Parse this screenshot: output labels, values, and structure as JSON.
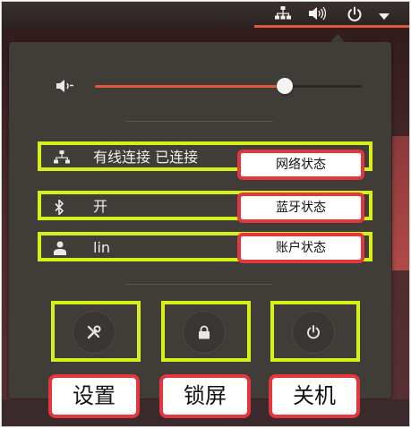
{
  "topbar": {
    "icons": [
      "network-wired-icon",
      "speaker-icon",
      "power-icon",
      "dropdown-arrow-icon"
    ]
  },
  "volume": {
    "icon": "speaker-low-icon",
    "level_percent": 71
  },
  "rows": [
    {
      "icon": "network-wired-icon",
      "label": "有线连接 已连接",
      "callout": "网络状态"
    },
    {
      "icon": "bluetooth-icon",
      "label": "开",
      "callout": "蓝牙状态"
    },
    {
      "icon": "user-icon",
      "label": "lin",
      "callout": "账户状态"
    }
  ],
  "buttons": [
    {
      "icon": "settings-tools-icon",
      "label": "设置"
    },
    {
      "icon": "lock-icon",
      "label": "锁屏"
    },
    {
      "icon": "power-icon",
      "label": "关机"
    }
  ],
  "colors": {
    "highlight_box": "#d8f01a",
    "callout_border": "#e4363c",
    "accent": "#e25a33",
    "menu_bg": "#403c38"
  }
}
